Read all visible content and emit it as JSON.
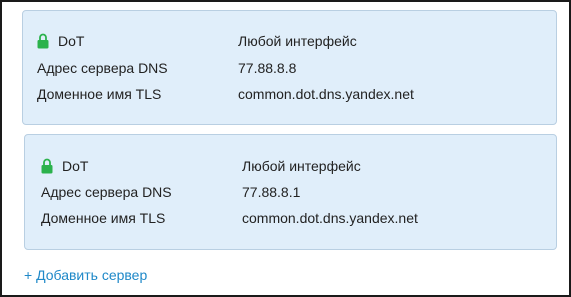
{
  "servers": [
    {
      "protocol": "DoT",
      "interface": "Любой интерфейс",
      "dns_label": "Адрес сервера DNS",
      "dns_value": "77.88.8.8",
      "tls_label": "Доменное имя TLS",
      "tls_value": "common.dot.dns.yandex.net"
    },
    {
      "protocol": "DoT",
      "interface": "Любой интерфейс",
      "dns_label": "Адрес сервера DNS",
      "dns_value": "77.88.8.1",
      "tls_label": "Доменное имя TLS",
      "tls_value": "common.dot.dns.yandex.net"
    }
  ],
  "add_server_label": "+ Добавить сервер",
  "colors": {
    "card_background": "#e0eefa",
    "lock_icon": "#2bb24c",
    "link": "#1e88c8"
  }
}
